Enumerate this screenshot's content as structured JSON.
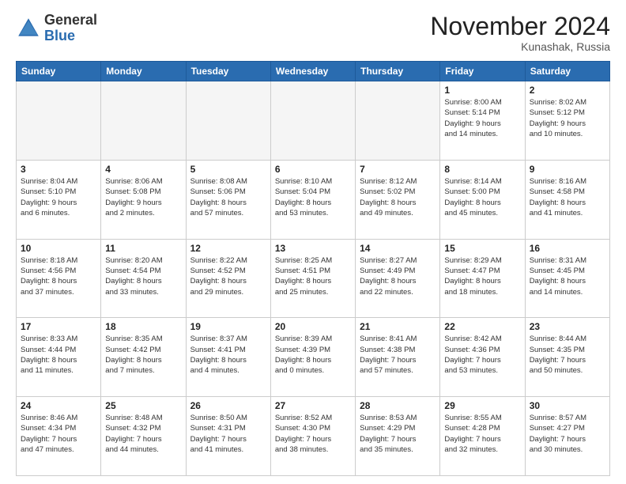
{
  "header": {
    "logo_general": "General",
    "logo_blue": "Blue",
    "month_title": "November 2024",
    "location": "Kunashak, Russia"
  },
  "days_of_week": [
    "Sunday",
    "Monday",
    "Tuesday",
    "Wednesday",
    "Thursday",
    "Friday",
    "Saturday"
  ],
  "weeks": [
    [
      {
        "day": "",
        "info": "",
        "empty": true
      },
      {
        "day": "",
        "info": "",
        "empty": true
      },
      {
        "day": "",
        "info": "",
        "empty": true
      },
      {
        "day": "",
        "info": "",
        "empty": true
      },
      {
        "day": "",
        "info": "",
        "empty": true
      },
      {
        "day": "1",
        "info": "Sunrise: 8:00 AM\nSunset: 5:14 PM\nDaylight: 9 hours\nand 14 minutes."
      },
      {
        "day": "2",
        "info": "Sunrise: 8:02 AM\nSunset: 5:12 PM\nDaylight: 9 hours\nand 10 minutes."
      }
    ],
    [
      {
        "day": "3",
        "info": "Sunrise: 8:04 AM\nSunset: 5:10 PM\nDaylight: 9 hours\nand 6 minutes."
      },
      {
        "day": "4",
        "info": "Sunrise: 8:06 AM\nSunset: 5:08 PM\nDaylight: 9 hours\nand 2 minutes."
      },
      {
        "day": "5",
        "info": "Sunrise: 8:08 AM\nSunset: 5:06 PM\nDaylight: 8 hours\nand 57 minutes."
      },
      {
        "day": "6",
        "info": "Sunrise: 8:10 AM\nSunset: 5:04 PM\nDaylight: 8 hours\nand 53 minutes."
      },
      {
        "day": "7",
        "info": "Sunrise: 8:12 AM\nSunset: 5:02 PM\nDaylight: 8 hours\nand 49 minutes."
      },
      {
        "day": "8",
        "info": "Sunrise: 8:14 AM\nSunset: 5:00 PM\nDaylight: 8 hours\nand 45 minutes."
      },
      {
        "day": "9",
        "info": "Sunrise: 8:16 AM\nSunset: 4:58 PM\nDaylight: 8 hours\nand 41 minutes."
      }
    ],
    [
      {
        "day": "10",
        "info": "Sunrise: 8:18 AM\nSunset: 4:56 PM\nDaylight: 8 hours\nand 37 minutes."
      },
      {
        "day": "11",
        "info": "Sunrise: 8:20 AM\nSunset: 4:54 PM\nDaylight: 8 hours\nand 33 minutes."
      },
      {
        "day": "12",
        "info": "Sunrise: 8:22 AM\nSunset: 4:52 PM\nDaylight: 8 hours\nand 29 minutes."
      },
      {
        "day": "13",
        "info": "Sunrise: 8:25 AM\nSunset: 4:51 PM\nDaylight: 8 hours\nand 25 minutes."
      },
      {
        "day": "14",
        "info": "Sunrise: 8:27 AM\nSunset: 4:49 PM\nDaylight: 8 hours\nand 22 minutes."
      },
      {
        "day": "15",
        "info": "Sunrise: 8:29 AM\nSunset: 4:47 PM\nDaylight: 8 hours\nand 18 minutes."
      },
      {
        "day": "16",
        "info": "Sunrise: 8:31 AM\nSunset: 4:45 PM\nDaylight: 8 hours\nand 14 minutes."
      }
    ],
    [
      {
        "day": "17",
        "info": "Sunrise: 8:33 AM\nSunset: 4:44 PM\nDaylight: 8 hours\nand 11 minutes."
      },
      {
        "day": "18",
        "info": "Sunrise: 8:35 AM\nSunset: 4:42 PM\nDaylight: 8 hours\nand 7 minutes."
      },
      {
        "day": "19",
        "info": "Sunrise: 8:37 AM\nSunset: 4:41 PM\nDaylight: 8 hours\nand 4 minutes."
      },
      {
        "day": "20",
        "info": "Sunrise: 8:39 AM\nSunset: 4:39 PM\nDaylight: 8 hours\nand 0 minutes."
      },
      {
        "day": "21",
        "info": "Sunrise: 8:41 AM\nSunset: 4:38 PM\nDaylight: 7 hours\nand 57 minutes."
      },
      {
        "day": "22",
        "info": "Sunrise: 8:42 AM\nSunset: 4:36 PM\nDaylight: 7 hours\nand 53 minutes."
      },
      {
        "day": "23",
        "info": "Sunrise: 8:44 AM\nSunset: 4:35 PM\nDaylight: 7 hours\nand 50 minutes."
      }
    ],
    [
      {
        "day": "24",
        "info": "Sunrise: 8:46 AM\nSunset: 4:34 PM\nDaylight: 7 hours\nand 47 minutes."
      },
      {
        "day": "25",
        "info": "Sunrise: 8:48 AM\nSunset: 4:32 PM\nDaylight: 7 hours\nand 44 minutes."
      },
      {
        "day": "26",
        "info": "Sunrise: 8:50 AM\nSunset: 4:31 PM\nDaylight: 7 hours\nand 41 minutes."
      },
      {
        "day": "27",
        "info": "Sunrise: 8:52 AM\nSunset: 4:30 PM\nDaylight: 7 hours\nand 38 minutes."
      },
      {
        "day": "28",
        "info": "Sunrise: 8:53 AM\nSunset: 4:29 PM\nDaylight: 7 hours\nand 35 minutes."
      },
      {
        "day": "29",
        "info": "Sunrise: 8:55 AM\nSunset: 4:28 PM\nDaylight: 7 hours\nand 32 minutes."
      },
      {
        "day": "30",
        "info": "Sunrise: 8:57 AM\nSunset: 4:27 PM\nDaylight: 7 hours\nand 30 minutes."
      }
    ]
  ]
}
